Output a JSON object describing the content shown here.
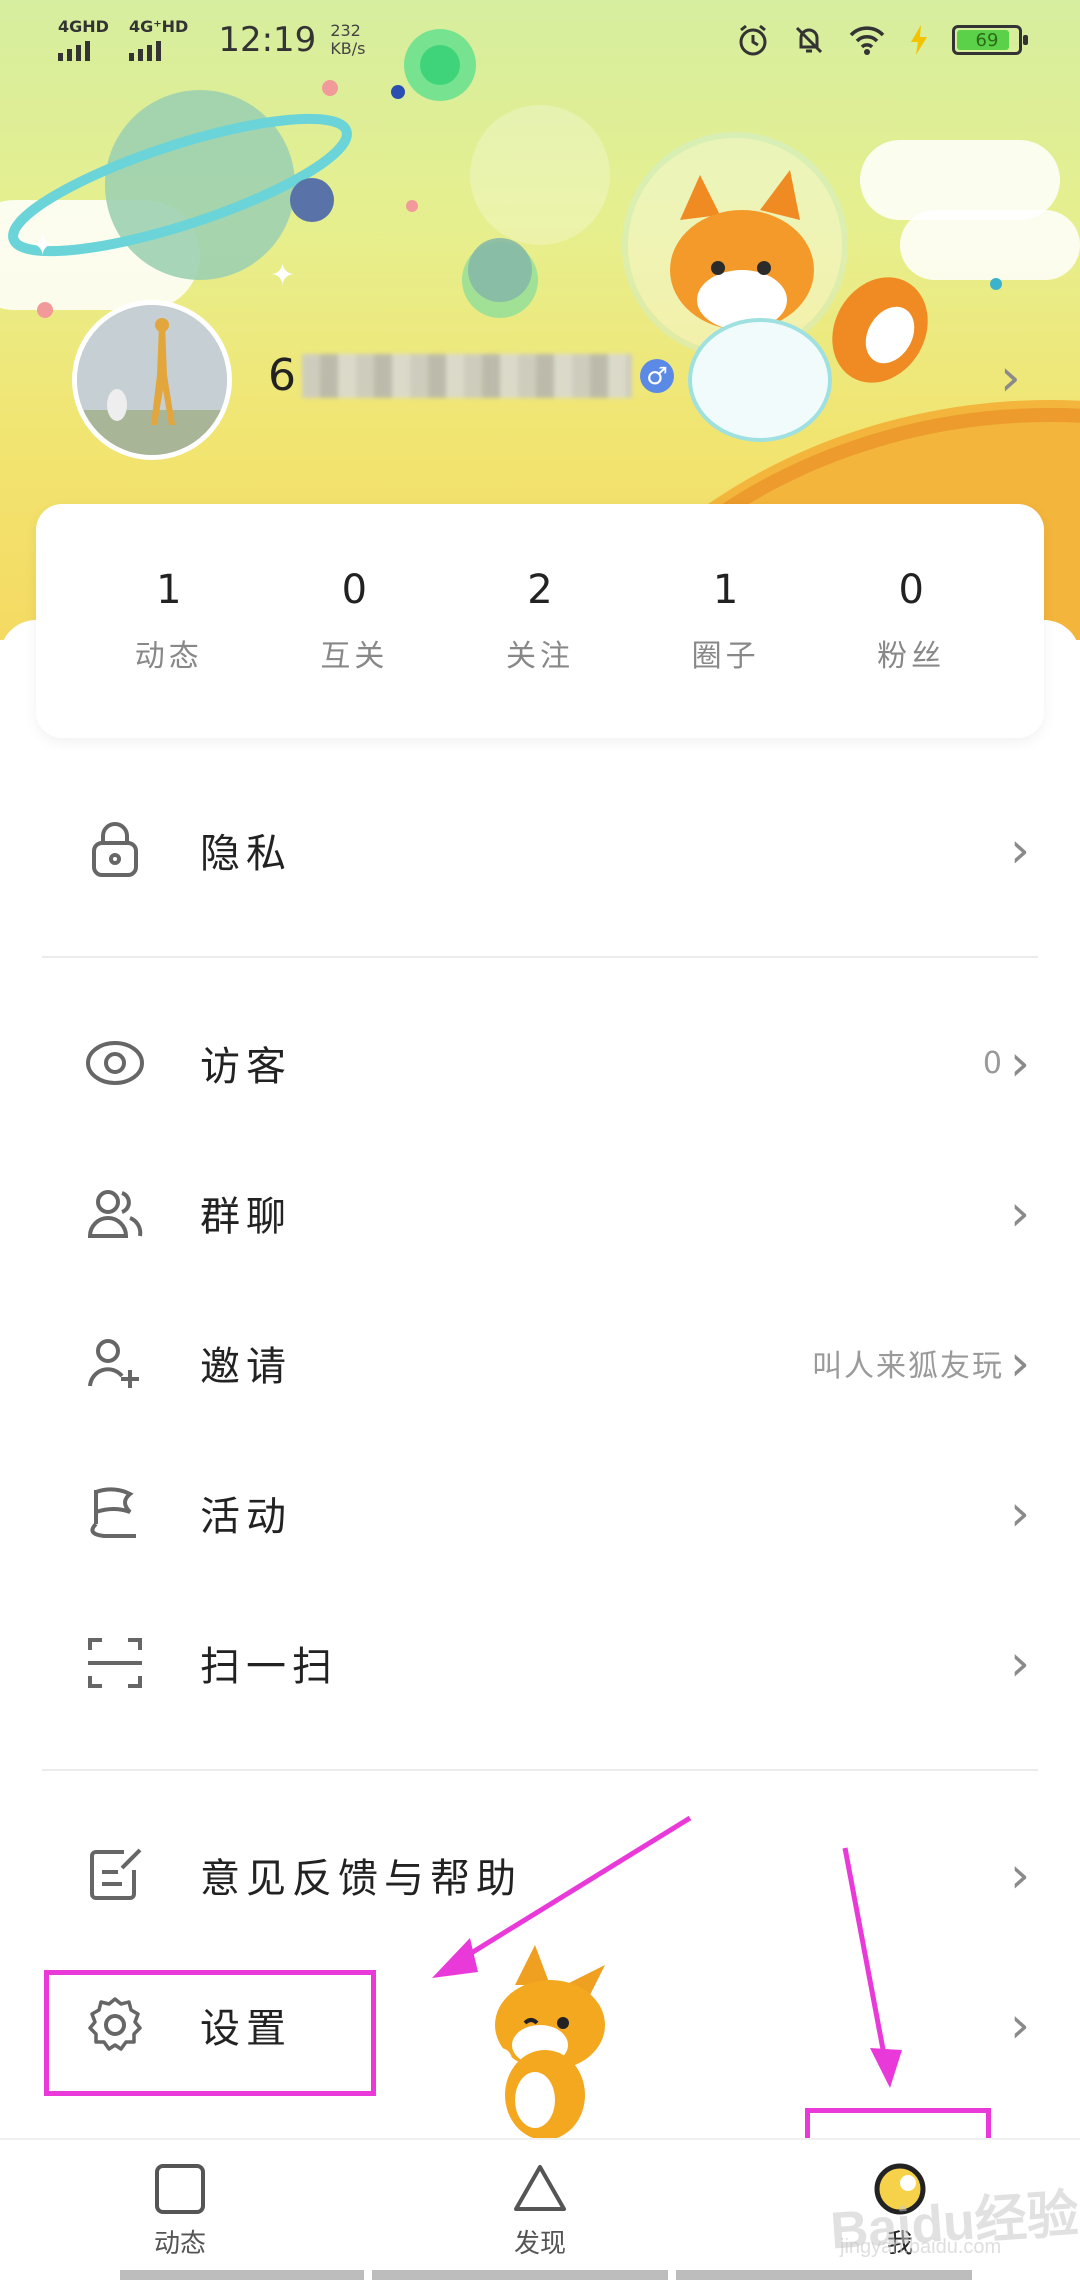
{
  "status_bar": {
    "net1": "4GHD",
    "net2": "4G⁺HD",
    "time": "12:19",
    "speed_value": "232",
    "speed_unit": "KB/s",
    "battery": "69"
  },
  "profile": {
    "username_visible": "6"
  },
  "stats": [
    {
      "value": "1",
      "label": "动态"
    },
    {
      "value": "0",
      "label": "互关"
    },
    {
      "value": "2",
      "label": "关注"
    },
    {
      "value": "1",
      "label": "圈子"
    },
    {
      "value": "0",
      "label": "粉丝"
    }
  ],
  "menu": {
    "privacy": {
      "label": "隐私"
    },
    "visitors": {
      "label": "访客",
      "value": "0"
    },
    "group_chat": {
      "label": "群聊"
    },
    "invite": {
      "label": "邀请",
      "value": "叫人来狐友玩"
    },
    "activity": {
      "label": "活动"
    },
    "scan": {
      "label": "扫一扫"
    },
    "feedback": {
      "label": "意见反馈与帮助"
    },
    "settings": {
      "label": "设置"
    }
  },
  "bottom_nav": [
    {
      "label": "动态",
      "icon": "square-icon"
    },
    {
      "label": "发现",
      "icon": "triangle-icon"
    },
    {
      "label": "我",
      "icon": "me-circle-icon"
    }
  ],
  "annotation_color": "#e93ad9",
  "watermark": {
    "text": "Baidu经验",
    "sub": "jingyan.baidu.com"
  }
}
